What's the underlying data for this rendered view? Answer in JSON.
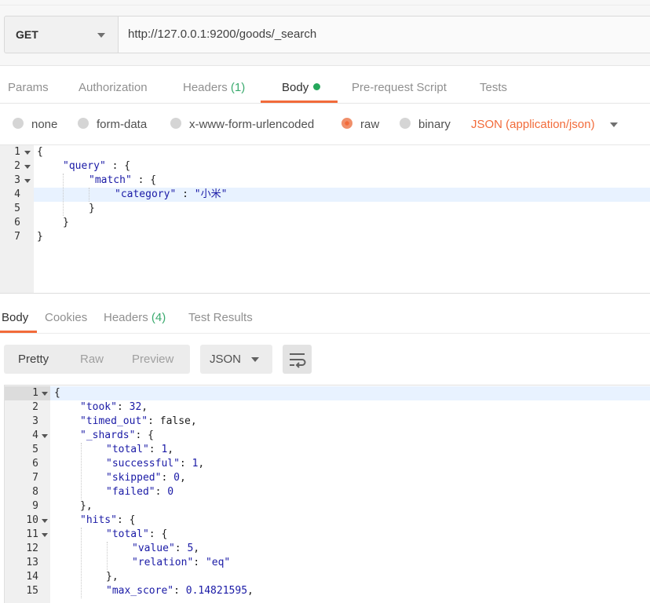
{
  "request": {
    "method": "GET",
    "url": "http://127.0.0.1:9200/goods/_search"
  },
  "request_tabs": {
    "params": "Params",
    "authorization": "Authorization",
    "headers": "Headers",
    "headers_count": "(1)",
    "body": "Body",
    "prerequest": "Pre-request Script",
    "tests": "Tests"
  },
  "body_types": {
    "none": "none",
    "form_data": "form-data",
    "urlencoded": "x-www-form-urlencoded",
    "raw": "raw",
    "binary": "binary",
    "selected": "raw",
    "content_type": "JSON (application/json)"
  },
  "request_body": {
    "line_numbers": [
      "1",
      "2",
      "3",
      "4",
      "5",
      "6",
      "7"
    ],
    "lines": {
      "l1": "{",
      "l2_key": "\"query\"",
      "l2_rest": " : {",
      "l3_key": "\"match\"",
      "l3_rest": " : {",
      "l4_key": "\"category\"",
      "l4_mid": " : ",
      "l4_val": "\"小米\"",
      "l5": "}",
      "l6": "}",
      "l7": "}"
    }
  },
  "response_tabs": {
    "body": "Body",
    "cookies": "Cookies",
    "headers": "Headers",
    "headers_count": "(4)",
    "test_results": "Test Results"
  },
  "response_view": {
    "pretty": "Pretty",
    "raw": "Raw",
    "preview": "Preview",
    "format": "JSON",
    "wrap_icon": "wrap-lines-icon"
  },
  "response_body": {
    "line_numbers": [
      "1",
      "2",
      "3",
      "4",
      "5",
      "6",
      "7",
      "8",
      "9",
      "10",
      "11",
      "12",
      "13",
      "14",
      "15"
    ],
    "lines": {
      "l1": "{",
      "l2_key": "\"took\"",
      "l2_val": "32",
      "l3_key": "\"timed_out\"",
      "l3_val": "false",
      "l4_key": "\"_shards\"",
      "l5_key": "\"total\"",
      "l5_val": "1",
      "l6_key": "\"successful\"",
      "l6_val": "1",
      "l7_key": "\"skipped\"",
      "l7_val": "0",
      "l8_key": "\"failed\"",
      "l8_val": "0",
      "l9": "},",
      "l10_key": "\"hits\"",
      "l11_key": "\"total\"",
      "l12_key": "\"value\"",
      "l12_val": "5",
      "l13_key": "\"relation\"",
      "l13_val": "\"eq\"",
      "l14": "},",
      "l15_key": "\"max_score\"",
      "l15_val": "0.14821595"
    }
  },
  "colors": {
    "accent": "#f26b3a",
    "count_green": "#3aaa6e",
    "json_key": "#1a1aa6"
  }
}
